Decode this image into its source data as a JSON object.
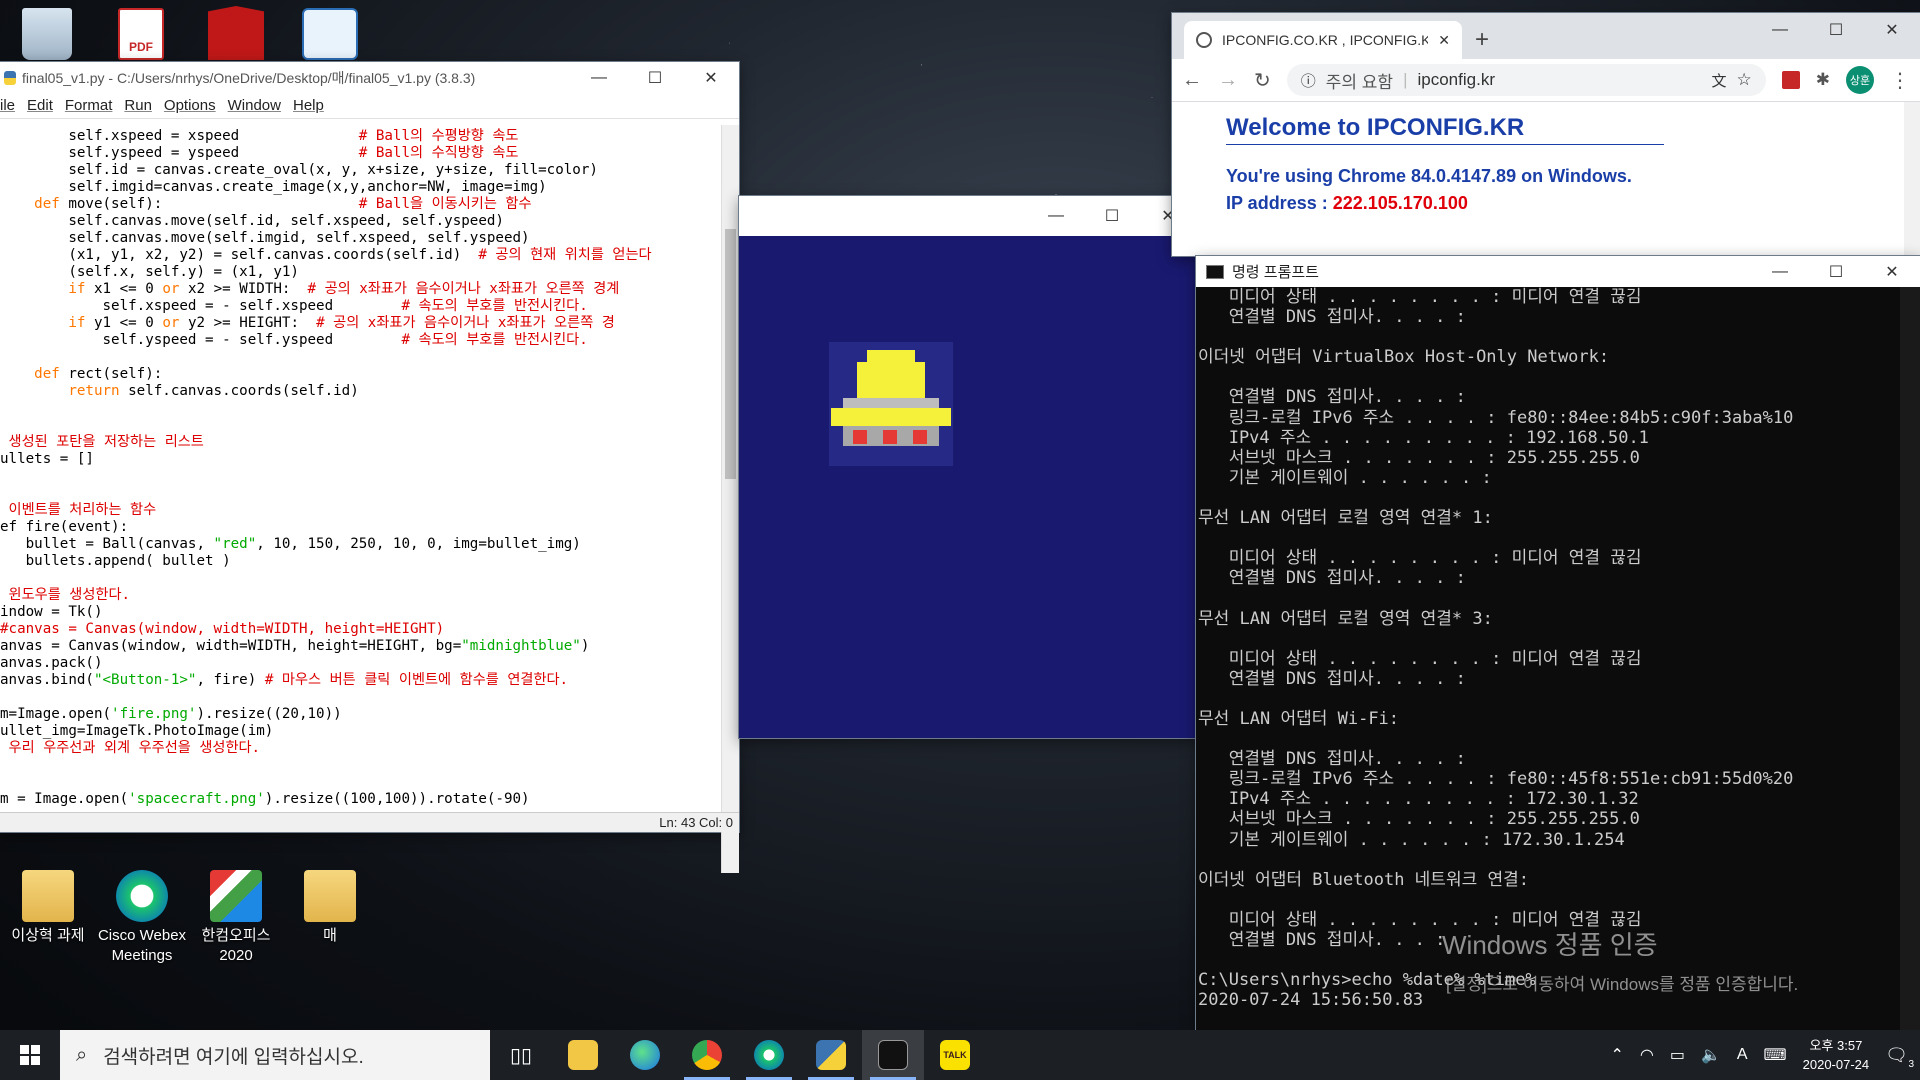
{
  "desktop": {
    "icons": [
      {
        "label": "이상혁 과제",
        "kind": "folder"
      },
      {
        "label": "Cisco Webex Meetings",
        "kind": "webex"
      },
      {
        "label": "한컴오피스 2020",
        "kind": "hancom"
      },
      {
        "label": "매",
        "kind": "folder"
      }
    ]
  },
  "idle": {
    "title": "final05_v1.py - C:/Users/nrhys/OneDrive/Desktop/매/final05_v1.py (3.8.3)",
    "menu": [
      "ile",
      "Edit",
      "Format",
      "Run",
      "Options",
      "Window",
      "Help"
    ],
    "status": "Ln: 43   Col: 0",
    "lines": [
      "        self.xspeed = xspeed              # Ball의 수평방향 속도",
      "        self.yspeed = yspeed              # Ball의 수직방향 속도",
      "        self.id = canvas.create_oval(x, y, x+size, y+size, fill=color)",
      "        self.imgid=canvas.create_image(x,y,anchor=NW, image=img)",
      "    def move(self):                       # Ball을 이동시키는 함수",
      "        self.canvas.move(self.id, self.xspeed, self.yspeed)",
      "        self.canvas.move(self.imgid, self.xspeed, self.yspeed)",
      "        (x1, y1, x2, y2) = self.canvas.coords(self.id)  # 공의 현재 위치를 얻는다",
      "        (self.x, self.y) = (x1, y1)",
      "        if x1 <= 0 or x2 >= WIDTH:  # 공의 x좌표가 음수이거나 x좌표가 오른쪽 경계",
      "            self.xspeed = - self.xspeed        # 속도의 부호를 반전시킨다.",
      "        if y1 <= 0 or y2 >= HEIGHT:  # 공의 x좌표가 음수이거나 x좌표가 오른쪽 경",
      "            self.yspeed = - self.yspeed        # 속도의 부호를 반전시킨다.",
      "",
      "    def rect(self):",
      "        return self.canvas.coords(self.id)",
      "",
      "",
      " 생성된 포탄을 저장하는 리스트",
      "ullets = []",
      "",
      "",
      " 이벤트를 처리하는 함수",
      "ef fire(event):",
      "   bullet = Ball(canvas, \"red\", 10, 150, 250, 10, 0, img=bullet_img)",
      "   bullets.append( bullet )",
      "",
      " 윈도우를 생성한다.",
      "indow = Tk()",
      "#canvas = Canvas(window, width=WIDTH, height=HEIGHT)",
      "anvas = Canvas(window, width=WIDTH, height=HEIGHT, bg=\"midnightblue\")",
      "anvas.pack()",
      "anvas.bind(\"<Button-1>\", fire) # 마우스 버튼 클릭 이벤트에 함수를 연결한다.",
      "",
      "m=Image.open('fire.png').resize((20,10))",
      "ullet_img=ImageTk.PhotoImage(im)",
      " 우리 우주선과 외계 우주선을 생성한다.",
      "",
      "",
      "m = Image.open('spacecraft.png').resize((100,100)).rotate(-90)"
    ]
  },
  "chrome": {
    "tab_title": "IPCONFIG.CO.KR , IPCONFIG.KR",
    "security_label": "주의 요함",
    "url": "ipconfig.kr",
    "profile": "상훈",
    "heading": "Welcome to IPCONFIG.KR",
    "browser_prefix": "You're using ",
    "browser_name": "Chrome 84.0.4147.89",
    "browser_suffix": " on Windows.",
    "ip_label": "IP address : ",
    "ip_value": "222.105.170.100"
  },
  "cmd": {
    "title": "명령 프롬프트",
    "lines": [
      "   미디어 상태 . . . . . . . . : 미디어 연결 끊김",
      "   연결별 DNS 접미사. . . . :",
      "",
      "이더넷 어댑터 VirtualBox Host-Only Network:",
      "",
      "   연결별 DNS 접미사. . . . :",
      "   링크-로컬 IPv6 주소 . . . . : fe80::84ee:84b5:c90f:3aba%10",
      "   IPv4 주소 . . . . . . . . . : 192.168.50.1",
      "   서브넷 마스크 . . . . . . . : 255.255.255.0",
      "   기본 게이트웨이 . . . . . . :",
      "",
      "무선 LAN 어댑터 로컬 영역 연결* 1:",
      "",
      "   미디어 상태 . . . . . . . . : 미디어 연결 끊김",
      "   연결별 DNS 접미사. . . . :",
      "",
      "무선 LAN 어댑터 로컬 영역 연결* 3:",
      "",
      "   미디어 상태 . . . . . . . . : 미디어 연결 끊김",
      "   연결별 DNS 접미사. . . . :",
      "",
      "무선 LAN 어댑터 Wi-Fi:",
      "",
      "   연결별 DNS 접미사. . . . :",
      "   링크-로컬 IPv6 주소 . . . . : fe80::45f8:551e:cb91:55d0%20",
      "   IPv4 주소 . . . . . . . . . : 172.30.1.32",
      "   서브넷 마스크 . . . . . . . : 255.255.255.0",
      "   기본 게이트웨이 . . . . . . : 172.30.1.254",
      "",
      "이더넷 어댑터 Bluetooth 네트워크 연결:",
      "",
      "   미디어 상태 . . . . . . . . : 미디어 연결 끊김",
      "   연결별 DNS 접미사. . . :",
      "",
      "C:\\Users\\nrhys>echo %date% %time%",
      "2020-07-24 15:56:50.83"
    ]
  },
  "activation": {
    "title": "Windows 정품 인증",
    "subtitle": "[설정]으로 이동하여 Windows를 정품 인증합니다."
  },
  "taskbar": {
    "search_placeholder": "검색하려면 여기에 입력하십시오.",
    "time": "오후 3:57",
    "date": "2020-07-24",
    "notification_count": "3",
    "ime": "A"
  }
}
